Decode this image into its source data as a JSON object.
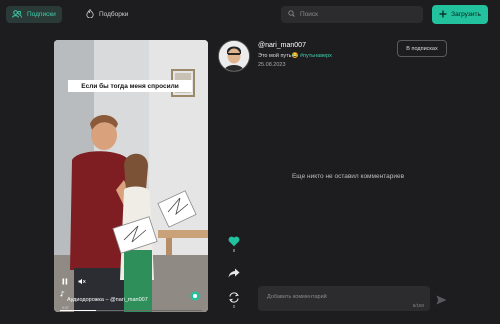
{
  "topbar": {
    "tab_subscriptions": "Подписки",
    "tab_recommendations": "Подборки",
    "search_placeholder": "Поиск",
    "upload_label": "Загрузить"
  },
  "video": {
    "caption": "Если бы тогда меня спросили",
    "audio_label": "Аудиодорожка – @nari_man007",
    "time": "0:07",
    "progress_fraction": 0.25
  },
  "post": {
    "username": "@nari_man007",
    "description": "Это мой путь😂",
    "hashtag": "#путьнаверх",
    "date": "25.08.2023",
    "subscribe_label": "В подписках"
  },
  "actions": {
    "likes": "8",
    "reposts": "0"
  },
  "comments": {
    "empty_text": "Еще никто не оставил комментариев",
    "placeholder": "Добавить комментарий",
    "counter": "5/150"
  },
  "colors": {
    "accent": "#21c29d",
    "background": "#1d1d1f"
  },
  "icons": [
    "subscriptions-icon",
    "fire-icon",
    "search-icon",
    "plus-icon",
    "play-pause-icon",
    "mute-icon",
    "music-note-icon",
    "heart-icon",
    "share-arrow-icon",
    "repost-icon",
    "send-icon"
  ]
}
